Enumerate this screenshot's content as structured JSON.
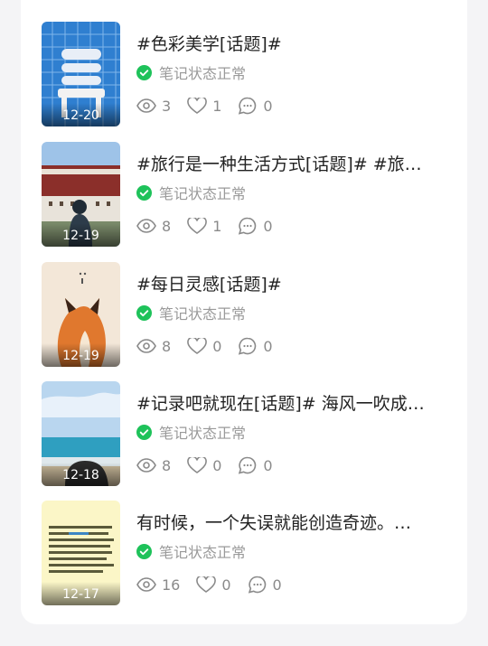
{
  "status_label": "笔记状态正常",
  "colors": {
    "accent_green": "#1ec25a",
    "muted": "#8a8a8a"
  },
  "notes": [
    {
      "title": "#色彩美学[话题]#",
      "date": "12-20",
      "views": "3",
      "likes": "1",
      "comments": "0",
      "thumb_icon": "chair-photo"
    },
    {
      "title": "#旅行是一种生活方式[话题]# #旅…",
      "date": "12-19",
      "views": "8",
      "likes": "1",
      "comments": "0",
      "thumb_icon": "palace-photo"
    },
    {
      "title": "#每日灵感[话题]#",
      "date": "12-19",
      "views": "8",
      "likes": "0",
      "comments": "0",
      "thumb_icon": "fox-illustration"
    },
    {
      "title": "#记录吧就现在[话题]# 海风一吹成…",
      "date": "12-18",
      "views": "8",
      "likes": "0",
      "comments": "0",
      "thumb_icon": "sea-photo"
    },
    {
      "title": "有时候，一个失误就能创造奇迹。…",
      "date": "12-17",
      "views": "16",
      "likes": "0",
      "comments": "0",
      "thumb_icon": "text-poster"
    }
  ]
}
